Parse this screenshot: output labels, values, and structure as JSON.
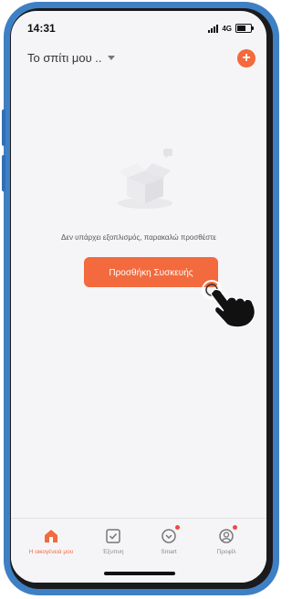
{
  "status": {
    "time": "14:31",
    "network": "4G"
  },
  "header": {
    "home_name": "Το σπίτι μου .."
  },
  "empty_state": {
    "message": "Δεν υπάρχει εξοπλισμός, παρακαλώ προσθέστε",
    "add_button_label": "Προσθήκη Συσκευής"
  },
  "tabs": [
    {
      "label": "Η οικογένειά μου",
      "icon": "home-icon",
      "active": true
    },
    {
      "label": "Έξυπνη",
      "icon": "checklist-icon",
      "active": false
    },
    {
      "label": "Smart",
      "icon": "smart-scene-icon",
      "active": false
    },
    {
      "label": "Προφίλ",
      "icon": "profile-icon",
      "active": false
    }
  ],
  "colors": {
    "accent": "#f26a3d",
    "frame": "#3f7fc4",
    "background": "#f5f5f7"
  }
}
